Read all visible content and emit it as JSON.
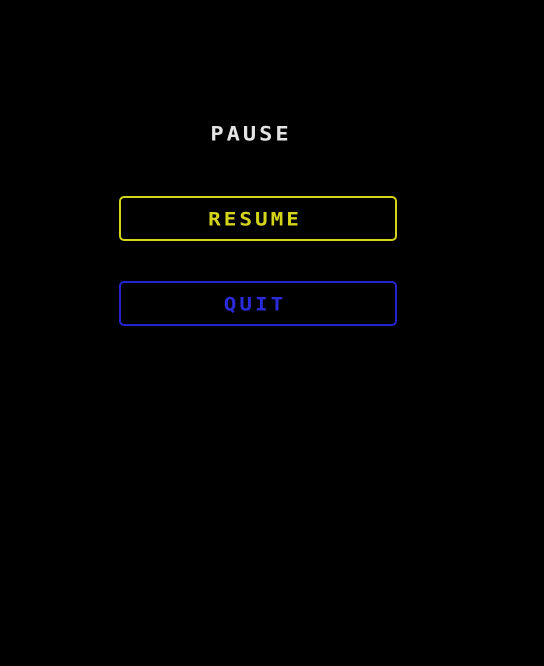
{
  "pause_menu": {
    "title": "PAUSE",
    "buttons": [
      {
        "label": "RESUME",
        "color": "#d4d41a"
      },
      {
        "label": "QUIT",
        "color": "#2424d0"
      }
    ]
  },
  "colors": {
    "background": "#000000",
    "title": "#e4e4e4"
  }
}
